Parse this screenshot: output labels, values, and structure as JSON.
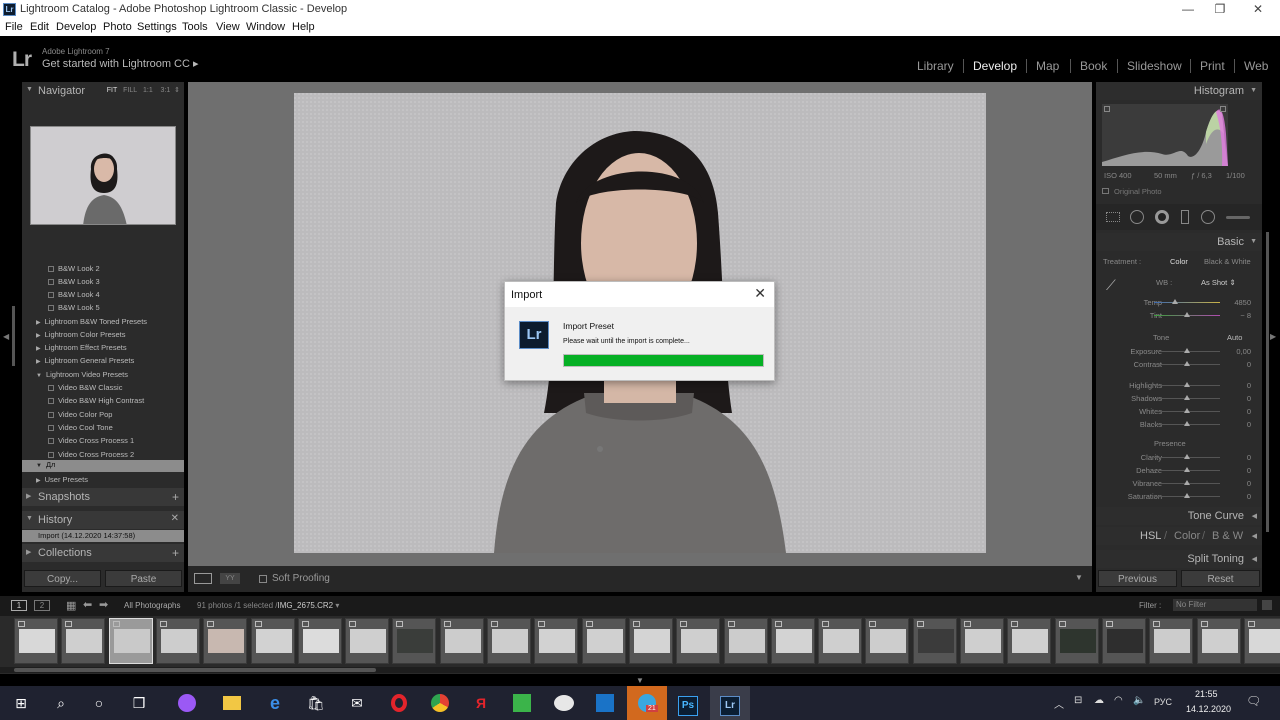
{
  "window": {
    "title": "Lightroom Catalog - Adobe Photoshop Lightroom Classic - Develop",
    "app_icon": "Lr"
  },
  "menu": [
    "File",
    "Edit",
    "Develop",
    "Photo",
    "Settings",
    "Tools",
    "View",
    "Window",
    "Help"
  ],
  "identity": {
    "logo": "Lr",
    "small": "Adobe Lightroom 7",
    "big": "Get started with Lightroom CC",
    "arrow": "▸"
  },
  "modules": [
    {
      "label": "Library",
      "active": false
    },
    {
      "label": "Develop",
      "active": true
    },
    {
      "label": "Map",
      "active": false
    },
    {
      "label": "Book",
      "active": false
    },
    {
      "label": "Slideshow",
      "active": false
    },
    {
      "label": "Print",
      "active": false
    },
    {
      "label": "Web",
      "active": false
    }
  ],
  "navigator": {
    "title": "Navigator",
    "options": [
      "FIT",
      "FILL",
      "1:1",
      "3:1"
    ]
  },
  "presets": [
    {
      "label": "B&W Look 2",
      "kind": "item"
    },
    {
      "label": "B&W Look 3",
      "kind": "item"
    },
    {
      "label": "B&W Look 4",
      "kind": "item"
    },
    {
      "label": "B&W Look 5",
      "kind": "item"
    },
    {
      "label": "Lightroom B&W Toned Presets",
      "kind": "group"
    },
    {
      "label": "Lightroom Color Presets",
      "kind": "group"
    },
    {
      "label": "Lightroom Effect Presets",
      "kind": "group"
    },
    {
      "label": "Lightroom General Presets",
      "kind": "group"
    },
    {
      "label": "Lightroom Video Presets",
      "kind": "group-open"
    },
    {
      "label": "Video B&W Classic",
      "kind": "item"
    },
    {
      "label": "Video B&W High Contrast",
      "kind": "item"
    },
    {
      "label": "Video Color Pop",
      "kind": "item"
    },
    {
      "label": "Video Cool Tone",
      "kind": "item"
    },
    {
      "label": "Video Cross Process 1",
      "kind": "item"
    },
    {
      "label": "Video Cross Process 2",
      "kind": "item"
    },
    {
      "label": "Дл",
      "kind": "selected"
    },
    {
      "label": "User Presets",
      "kind": "group"
    }
  ],
  "snapshots": {
    "title": "Snapshots"
  },
  "history": {
    "title": "History",
    "item": "Import (14.12.2020 14:37:58)"
  },
  "collections": {
    "title": "Collections"
  },
  "left_buttons": {
    "copy": "Copy...",
    "paste": "Paste"
  },
  "toolbar": {
    "soft_proofing": "Soft Proofing"
  },
  "histogram": {
    "title": "Histogram",
    "iso": "ISO 400",
    "focal": "50 mm",
    "aperture": "ƒ / 6,3",
    "shutter": "1/100",
    "original": "Original Photo"
  },
  "basic": {
    "title": "Basic",
    "treatment_label": "Treatment :",
    "treatment_color": "Color",
    "treatment_bw": "Black & White",
    "wb_label": "WB :",
    "wb_value": "As Shot",
    "temp_label": "Temp",
    "temp_value": "4850",
    "tint_label": "Tint",
    "tint_value": "− 8",
    "tone_label": "Tone",
    "auto_label": "Auto",
    "sliders_tone": [
      {
        "label": "Exposure",
        "value": "0,00"
      },
      {
        "label": "Contrast",
        "value": "0"
      },
      {
        "label": "Highlights",
        "value": "0"
      },
      {
        "label": "Shadows",
        "value": "0"
      },
      {
        "label": "Whites",
        "value": "0"
      },
      {
        "label": "Blacks",
        "value": "0"
      }
    ],
    "presence_label": "Presence",
    "sliders_presence": [
      {
        "label": "Clarity",
        "value": "0"
      },
      {
        "label": "Dehaze",
        "value": "0"
      },
      {
        "label": "Vibrance",
        "value": "0"
      },
      {
        "label": "Saturation",
        "value": "0"
      }
    ]
  },
  "tone_curve": {
    "title": "Tone Curve"
  },
  "hsl": {
    "hsl": "HSL",
    "color": "Color",
    "bw": "B & W"
  },
  "split_toning": {
    "title": "Split Toning"
  },
  "right_buttons": {
    "previous": "Previous",
    "reset": "Reset"
  },
  "filmstrip_bar": {
    "page1": "1",
    "page2": "2",
    "source": "All Photographs",
    "count": "91 photos /1 selected /",
    "filename": "IMG_2675.CR2",
    "filter_label": "Filter :",
    "filter_value": "No Filter"
  },
  "dialog": {
    "title": "Import",
    "close": "✕",
    "icon": "Lr",
    "heading": "Import Preset",
    "message": "Please wait until the import is complete...",
    "progress": 1.0
  },
  "taskbar": {
    "language": "РУС",
    "time": "21:55",
    "date": "14.12.2020",
    "telegram_badge": "21",
    "apps": [
      "windows-icon",
      "search-icon",
      "cortana-icon",
      "task-view-icon",
      "alice-icon",
      "explorer-icon",
      "edge-icon",
      "store-icon",
      "mail-icon",
      "opera-icon",
      "chrome-icon",
      "yandex-icon",
      "phone-icon",
      "wechat-icon",
      "outlook-icon",
      "telegram-icon",
      "photoshop-icon",
      "lightroom-icon"
    ]
  },
  "colors": {
    "progress_green": "#06b025",
    "panel_bg": "#2b2b2b",
    "center_bg": "#6f6f6f"
  }
}
